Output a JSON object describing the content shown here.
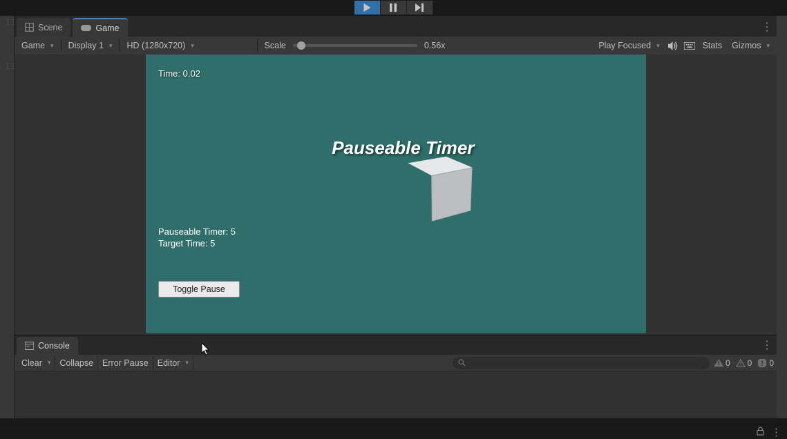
{
  "play_controls": {
    "play_active": true,
    "pause_active": false
  },
  "tabs": {
    "scene": "Scene",
    "game": "Game"
  },
  "game_toolbar": {
    "view_mode": "Game",
    "display": "Display 1",
    "resolution": "HD (1280x720)",
    "scale_label": "Scale",
    "scale_value": "0.56x",
    "focus_mode": "Play Focused",
    "stats": "Stats",
    "gizmos": "Gizmos"
  },
  "game_scene": {
    "time_prefix": "Time: ",
    "time_value": "0.02",
    "title": "Pauseable Timer",
    "pauseable_timer_label": "Pauseable Timer: ",
    "pauseable_timer_value": "5",
    "target_time_label": "Target Time: ",
    "target_time_value": "5",
    "toggle_button": "Toggle Pause"
  },
  "console": {
    "tab": "Console",
    "clear": "Clear",
    "collapse": "Collapse",
    "error_pause": "Error Pause",
    "editor": "Editor",
    "info_count": "0",
    "warn_count": "0",
    "error_count": "0"
  }
}
